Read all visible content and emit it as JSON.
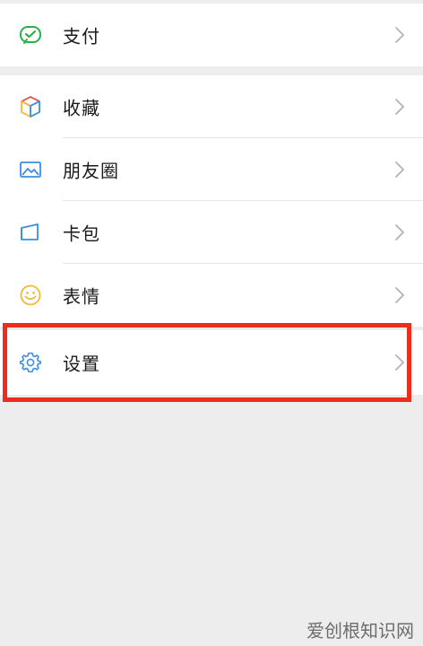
{
  "groups": [
    {
      "items": [
        {
          "label": "支付",
          "icon": "payment-check-icon"
        }
      ]
    },
    {
      "items": [
        {
          "label": "收藏",
          "icon": "favorites-cube-icon"
        },
        {
          "label": "朋友圈",
          "icon": "moments-photo-icon"
        },
        {
          "label": "卡包",
          "icon": "card-wallet-icon"
        },
        {
          "label": "表情",
          "icon": "sticker-smiley-icon"
        }
      ]
    },
    {
      "items": [
        {
          "label": "设置",
          "icon": "settings-gear-icon"
        }
      ]
    }
  ],
  "watermark": "爱创根知识网",
  "colors": {
    "background": "#ededed",
    "highlight": "#ee2d1f",
    "payment_green": "#2bb04a"
  }
}
